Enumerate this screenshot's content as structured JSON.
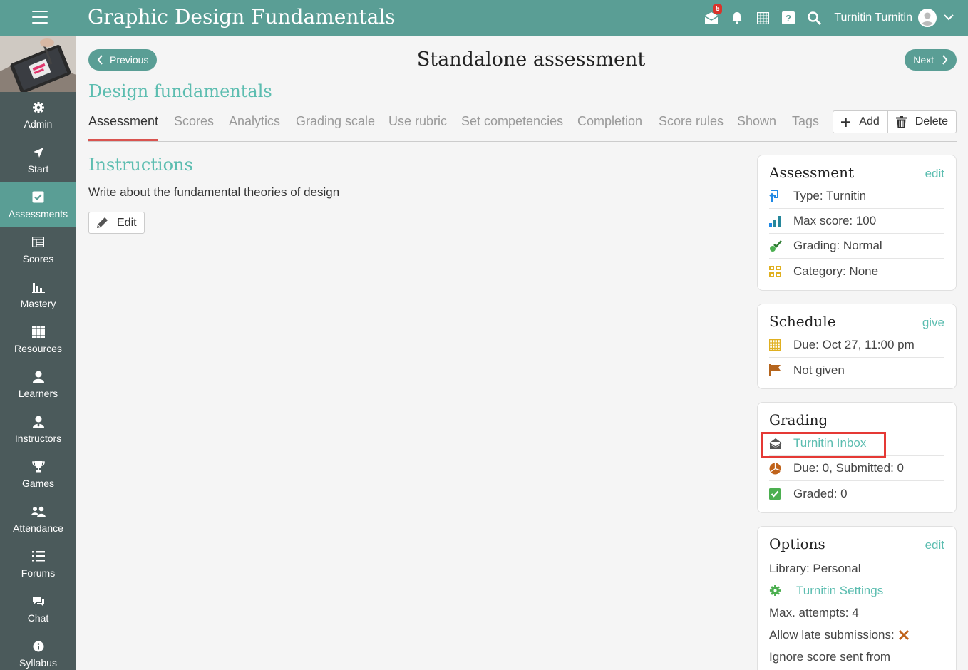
{
  "header": {
    "app_title": "Graphic Design Fundamentals",
    "mail_badge": "5",
    "user_name": "Turnitin Turnitin"
  },
  "sidebar": {
    "items": [
      {
        "label": "Admin",
        "icon": "gear-icon"
      },
      {
        "label": "Start",
        "icon": "send-icon"
      },
      {
        "label": "Assessments",
        "icon": "checkbox-icon",
        "active": true
      },
      {
        "label": "Scores",
        "icon": "scores-table-icon"
      },
      {
        "label": "Mastery",
        "icon": "bar-chart-icon"
      },
      {
        "label": "Resources",
        "icon": "books-icon"
      },
      {
        "label": "Learners",
        "icon": "user-icon"
      },
      {
        "label": "Instructors",
        "icon": "instructor-icon"
      },
      {
        "label": "Games",
        "icon": "trophy-icon"
      },
      {
        "label": "Attendance",
        "icon": "group-icon"
      },
      {
        "label": "Forums",
        "icon": "list-icon"
      },
      {
        "label": "Chat",
        "icon": "chat-icon"
      },
      {
        "label": "Syllabus",
        "icon": "info-icon"
      }
    ]
  },
  "nav": {
    "previous_label": "Previous",
    "next_label": "Next"
  },
  "page": {
    "title": "Standalone assessment",
    "section_title": "Design fundamentals"
  },
  "tabs": [
    {
      "label": "Assessment",
      "active": true
    },
    {
      "label": "Scores"
    },
    {
      "label": "Analytics"
    },
    {
      "label": "Grading scale"
    },
    {
      "label": "Use rubric"
    },
    {
      "label": "Set competencies"
    },
    {
      "label": "Completion"
    },
    {
      "label": "Score rules"
    },
    {
      "label": "Shown"
    },
    {
      "label": "Tags"
    }
  ],
  "tab_actions": {
    "add_label": "Add",
    "delete_label": "Delete"
  },
  "instructions": {
    "title": "Instructions",
    "text": "Write about the fundamental theories of design",
    "edit_label": "Edit"
  },
  "assessment_panel": {
    "title": "Assessment",
    "action": "edit",
    "rows": [
      {
        "text": "Type: Turnitin",
        "icon": "turnitin-icon",
        "color": "#1e88e5"
      },
      {
        "text": "Max score: 100",
        "icon": "bar-chart-icon",
        "color": "#26879b"
      },
      {
        "text": "Grading: Normal",
        "icon": "grading-check-icon",
        "color": "#4caf50"
      },
      {
        "text": "Category: None",
        "icon": "category-grid-icon",
        "color": "#e0b020"
      }
    ]
  },
  "schedule_panel": {
    "title": "Schedule",
    "action": "give",
    "rows": [
      {
        "text": "Due: Oct 27, 11:00 pm",
        "icon": "calendar-icon",
        "color": "#e0b020"
      },
      {
        "text": "Not given",
        "icon": "flag-icon",
        "color": "#b5651d"
      }
    ]
  },
  "grading_panel": {
    "title": "Grading",
    "rows": [
      {
        "text": "Turnitin Inbox",
        "icon": "open-envelope-icon",
        "color": "#555555",
        "link": true
      },
      {
        "text": "Due: 0, Submitted: 0",
        "icon": "pie-chart-icon",
        "color": "#c0631b"
      },
      {
        "text": "Graded: 0",
        "icon": "checkbox-icon",
        "color": "#4caf50"
      }
    ]
  },
  "options_panel": {
    "title": "Options",
    "action": "edit",
    "library": "Library: Personal",
    "turnitin_settings": "Turnitin Settings",
    "max_attempts": "Max. attempts: 4",
    "late_submissions": "Allow late submissions:",
    "ignore_score": "Ignore score sent from"
  },
  "colors": {
    "accent": "#5a9e95",
    "link": "#5cbdb0",
    "sidebar_bg": "#4b5a5b",
    "active_tab_underline": "#d9534f",
    "highlight": "#e53935"
  }
}
